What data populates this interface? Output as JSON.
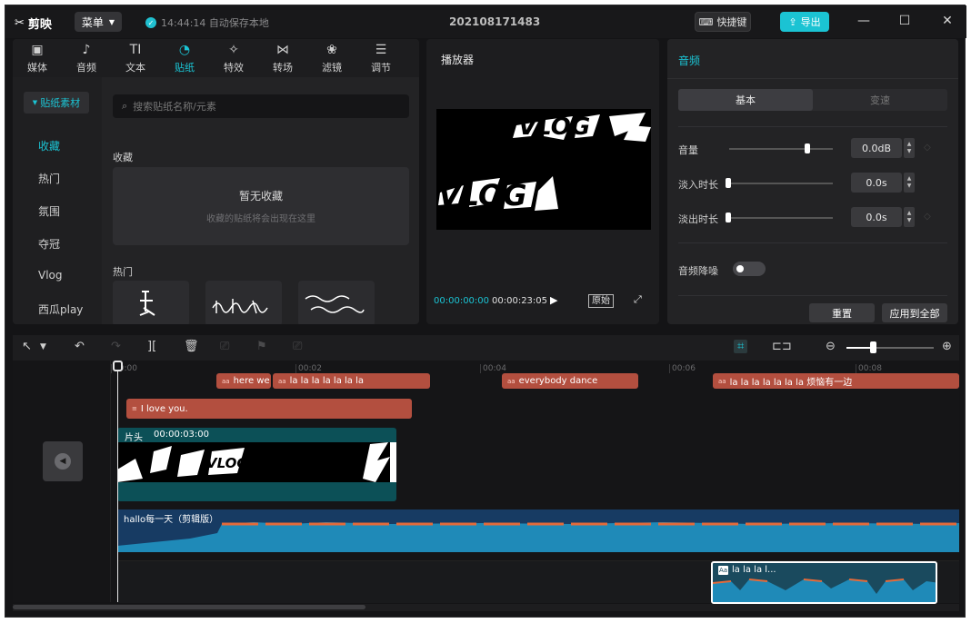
{
  "app": {
    "name": "剪映",
    "menu_label": "菜单",
    "save_status": "14:44:14 自动保存本地",
    "project_title": "202108171483",
    "shortcut_label": "快捷键",
    "export_label": "导出"
  },
  "toolbar": [
    {
      "label": "媒体",
      "icon": "media-icon"
    },
    {
      "label": "音频",
      "icon": "audio-icon"
    },
    {
      "label": "文本",
      "icon": "text-icon"
    },
    {
      "label": "贴纸",
      "icon": "sticker-icon"
    },
    {
      "label": "特效",
      "icon": "effects-icon"
    },
    {
      "label": "转场",
      "icon": "transition-icon"
    },
    {
      "label": "滤镜",
      "icon": "filter-icon"
    },
    {
      "label": "调节",
      "icon": "adjust-icon"
    }
  ],
  "sidebar": {
    "category": "贴纸素材",
    "items": [
      "收藏",
      "热门",
      "氛围",
      "夺冠",
      "Vlog",
      "西瓜play"
    ]
  },
  "search": {
    "placeholder": "搜索贴纸名称/元素"
  },
  "favorites": {
    "label": "收藏",
    "empty_title": "暂无收藏",
    "empty_sub": "收藏的贴纸将会出现在这里"
  },
  "hot": {
    "label": "热门"
  },
  "player": {
    "title": "播放器",
    "current_time": "00:00:00:00",
    "total_time": "00:00:23:05",
    "original_label": "原始",
    "video_text_a": "VLOG",
    "video_text_b": "VLOG"
  },
  "audio_panel": {
    "title": "音频",
    "tabs": [
      "基本",
      "变速"
    ],
    "volume_label": "音量",
    "volume_value": "0.0dB",
    "volume_level": 0.75,
    "fade_in_label": "淡入时长",
    "fade_in_value": "0.0s",
    "fade_out_label": "淡出时长",
    "fade_out_value": "0.0s",
    "denoise_label": "音频降噪",
    "reset_label": "重置",
    "apply_all_label": "应用到全部"
  },
  "ruler": [
    "00:00",
    "00:02",
    "00:04",
    "00:06",
    "00:08"
  ],
  "text_clips": [
    {
      "label": "here we"
    },
    {
      "label": "la la la la la la la"
    },
    {
      "label": "everybody dance"
    },
    {
      "label": "la la la la la la la 烦恼有一边"
    },
    {
      "label": "I love you."
    }
  ],
  "video_clip": {
    "label": "片头",
    "duration": "00:00:03:00",
    "thumb_text": "VLOG VLOG"
  },
  "audio_track": {
    "label": "hallo每一天（剪辑版）"
  },
  "sub_clip": {
    "label": "la la la l..."
  },
  "colors": {
    "accent": "#1bc3d3",
    "text_clip": "#b34f3f",
    "video_clip": "#0c5057",
    "audio_track": "#173b63"
  }
}
